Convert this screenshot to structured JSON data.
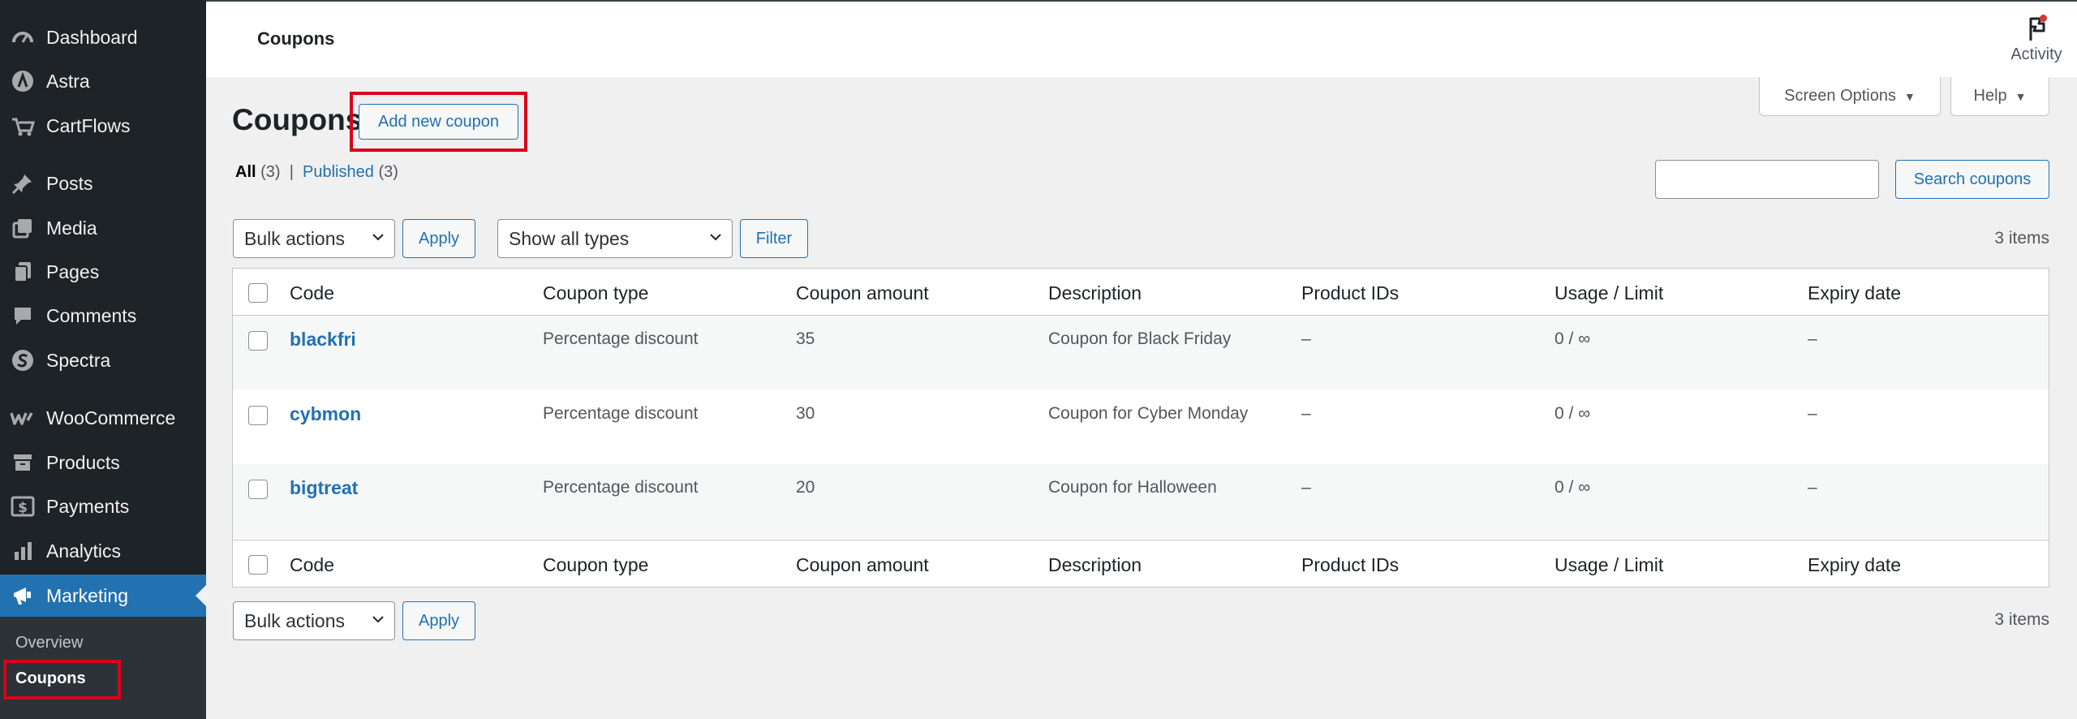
{
  "sidebar": {
    "items": [
      {
        "label": "Dashboard",
        "icon": "dashboard-icon"
      },
      {
        "label": "Astra",
        "icon": "astra-icon"
      },
      {
        "label": "CartFlows",
        "icon": "cartflows-icon"
      },
      {
        "label": "Posts",
        "icon": "pushpin-icon"
      },
      {
        "label": "Media",
        "icon": "media-icon"
      },
      {
        "label": "Pages",
        "icon": "pages-icon"
      },
      {
        "label": "Comments",
        "icon": "comment-icon"
      },
      {
        "label": "Spectra",
        "icon": "spectra-icon"
      },
      {
        "label": "WooCommerce",
        "icon": "woocommerce-icon"
      },
      {
        "label": "Products",
        "icon": "archive-icon"
      },
      {
        "label": "Payments",
        "icon": "dollar-icon"
      },
      {
        "label": "Analytics",
        "icon": "bar-chart-icon"
      },
      {
        "label": "Marketing",
        "icon": "megaphone-icon",
        "active": true
      }
    ],
    "submenu": [
      {
        "label": "Overview"
      },
      {
        "label": "Coupons",
        "current": true
      }
    ]
  },
  "header": {
    "title": "Coupons",
    "activity_label": "Activity"
  },
  "screen_options": {
    "label": "Screen Options"
  },
  "help": {
    "label": "Help"
  },
  "page": {
    "title": "Coupons",
    "add_new_label": "Add new coupon",
    "filters": {
      "all_label": "All",
      "all_count": "(3)",
      "separator": "|",
      "published_label": "Published",
      "published_count": "(3)"
    },
    "search": {
      "value": "",
      "button_label": "Search coupons"
    },
    "bulk_actions": {
      "selected": "Bulk actions",
      "apply_label": "Apply"
    },
    "type_filter": {
      "selected": "Show all types",
      "filter_label": "Filter"
    },
    "items_count": "3 items"
  },
  "table": {
    "columns": [
      "Code",
      "Coupon type",
      "Coupon amount",
      "Description",
      "Product IDs",
      "Usage / Limit",
      "Expiry date"
    ],
    "rows": [
      {
        "code": "blackfri",
        "type": "Percentage discount",
        "amount": "35",
        "description": "Coupon for Black Friday",
        "product_ids": "–",
        "usage": "0 / ∞",
        "expiry": "–"
      },
      {
        "code": "cybmon",
        "type": "Percentage discount",
        "amount": "30",
        "description": "Coupon for Cyber Monday",
        "product_ids": "–",
        "usage": "0 / ∞",
        "expiry": "–"
      },
      {
        "code": "bigtreat",
        "type": "Percentage discount",
        "amount": "20",
        "description": "Coupon for Halloween",
        "product_ids": "–",
        "usage": "0 / ∞",
        "expiry": "–"
      }
    ]
  },
  "colors": {
    "accent": "#2271b1",
    "sidebar_bg": "#1d2327",
    "highlight_box": "#d9001b"
  }
}
